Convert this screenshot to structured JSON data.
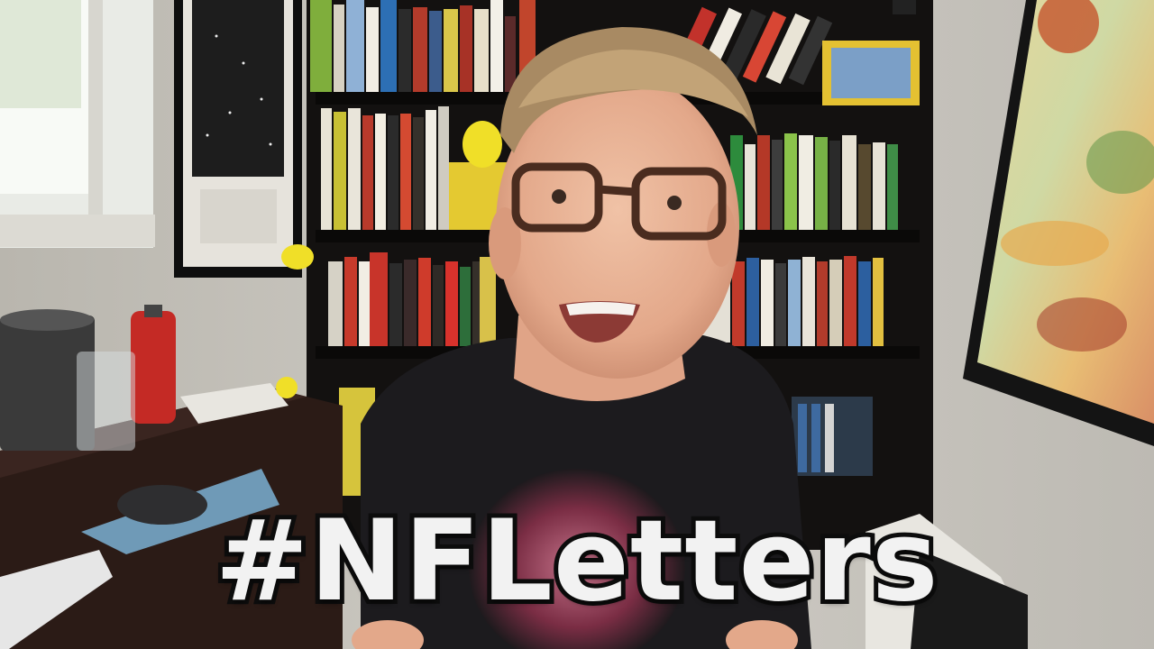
{
  "caption": {
    "text": "#NFLetters"
  },
  "scene": {
    "description_icons": [
      "bookshelf",
      "map-poster",
      "star-chart-poster",
      "window",
      "desk",
      "keyboard",
      "mouse",
      "water-bottle",
      "lamp"
    ],
    "colors": {
      "wall": "#c9c6bf",
      "shelf": "#141210",
      "desk": "#2a1b16",
      "caption_fill": "#f2f2f2",
      "caption_outline": "#0d0d0d"
    }
  }
}
